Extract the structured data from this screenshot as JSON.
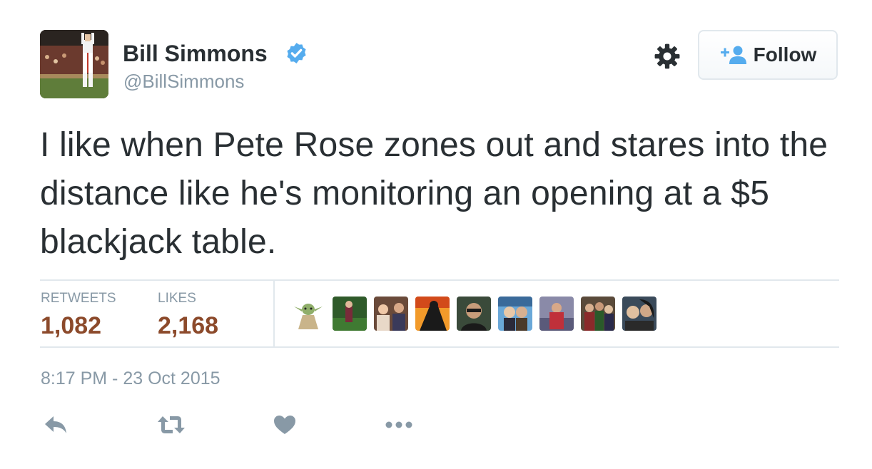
{
  "user": {
    "name": "Bill Simmons",
    "handle": "@BillSimmons"
  },
  "header": {
    "follow_label": "Follow"
  },
  "tweet": {
    "text": "I like when Pete Rose zones out and stares into the distance like he's monitoring an opening at a $5 blackjack table.",
    "timestamp": "8:17 PM - 23 Oct 2015"
  },
  "stats": {
    "retweets_label": "RETWEETS",
    "retweets_value": "1,082",
    "likes_label": "LIKES",
    "likes_value": "2,168"
  },
  "colors": {
    "stat_value": "#8c4a2b",
    "muted": "#8899a6",
    "verified": "#55acee",
    "border": "#e1e8ed"
  },
  "icons": {
    "reply": "reply-icon",
    "retweet": "retweet-icon",
    "like": "heart-icon",
    "more": "more-icon",
    "settings": "gear-icon",
    "verified": "verified-badge-icon"
  }
}
